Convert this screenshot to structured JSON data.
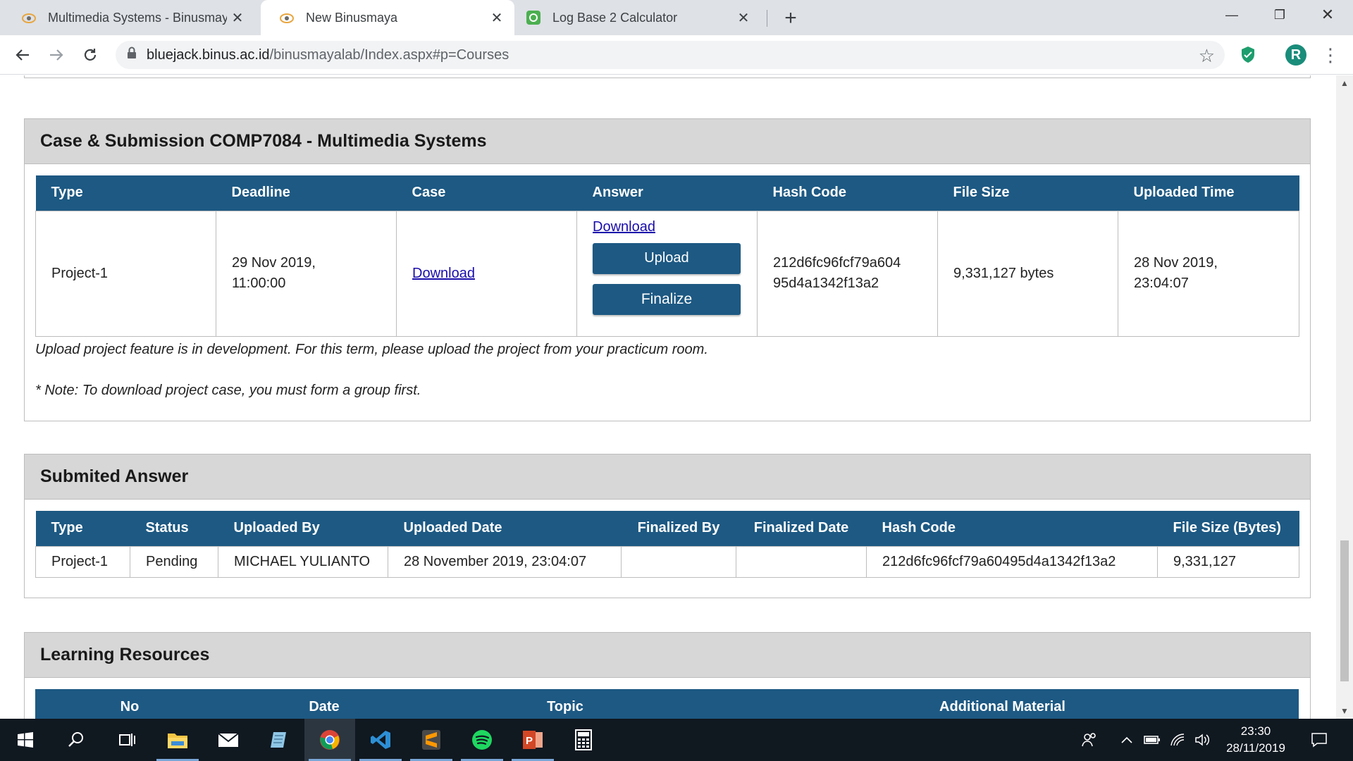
{
  "browser": {
    "tabs": [
      {
        "title": "Multimedia Systems - Binusmaya",
        "active": false
      },
      {
        "title": "New Binusmaya",
        "active": true
      },
      {
        "title": "Log Base 2 Calculator",
        "active": false
      }
    ],
    "url_host": "bluejack.binus.ac.id",
    "url_path": "/binusmayalab/Index.aspx#p=Courses",
    "profile_initial": "R"
  },
  "case_panel": {
    "title": "Case & Submission COMP7084 - Multimedia Systems",
    "headers": [
      "Type",
      "Deadline",
      "Case",
      "Answer",
      "Hash Code",
      "File Size",
      "Uploaded Time"
    ],
    "row": {
      "type": "Project-1",
      "deadline_line1": "29 Nov 2019,",
      "deadline_line2": "11:00:00",
      "case_link": "Download",
      "answer_link": "Download",
      "upload_label": "Upload",
      "finalize_label": "Finalize",
      "hash_line1": "212d6fc96fcf79a604",
      "hash_line2": "95d4a1342f13a2",
      "file_size": "9,331,127 bytes",
      "uploaded_line1": "28 Nov 2019,",
      "uploaded_line2": "23:04:07"
    },
    "note1": "Upload project feature is in development. For this term, please upload the project from your practicum room.",
    "note2": "* Note: To download project case, you must form a group first."
  },
  "submitted_panel": {
    "title": "Submited Answer",
    "headers": [
      "Type",
      "Status",
      "Uploaded By",
      "Uploaded Date",
      "Finalized By",
      "Finalized Date",
      "Hash Code",
      "File Size (Bytes)"
    ],
    "row": {
      "type": "Project-1",
      "status": "Pending",
      "uploaded_by": "MICHAEL YULIANTO",
      "uploaded_date": "28 November 2019, 23:04:07",
      "finalized_by": "",
      "finalized_date": "",
      "hash_code": "212d6fc96fcf79a60495d4a1342f13a2",
      "file_size": "9,331,127"
    }
  },
  "resources_panel": {
    "title": "Learning Resources",
    "headers": [
      "No",
      "Date",
      "Topic",
      "Additional Material"
    ]
  },
  "taskbar": {
    "time": "23:30",
    "date": "28/11/2019",
    "apps": [
      "start-icon",
      "search-icon",
      "task-view-icon",
      "file-explorer-icon",
      "mail-icon",
      "notepad-icon",
      "chrome-icon",
      "vscode-icon",
      "sublime-icon",
      "spotify-icon",
      "powerpoint-icon",
      "calculator-icon"
    ]
  },
  "colors": {
    "table_header": "#1d5983",
    "panel_header": "#d7d7d7",
    "link": "#1a0dab",
    "taskbar": "#101820"
  }
}
